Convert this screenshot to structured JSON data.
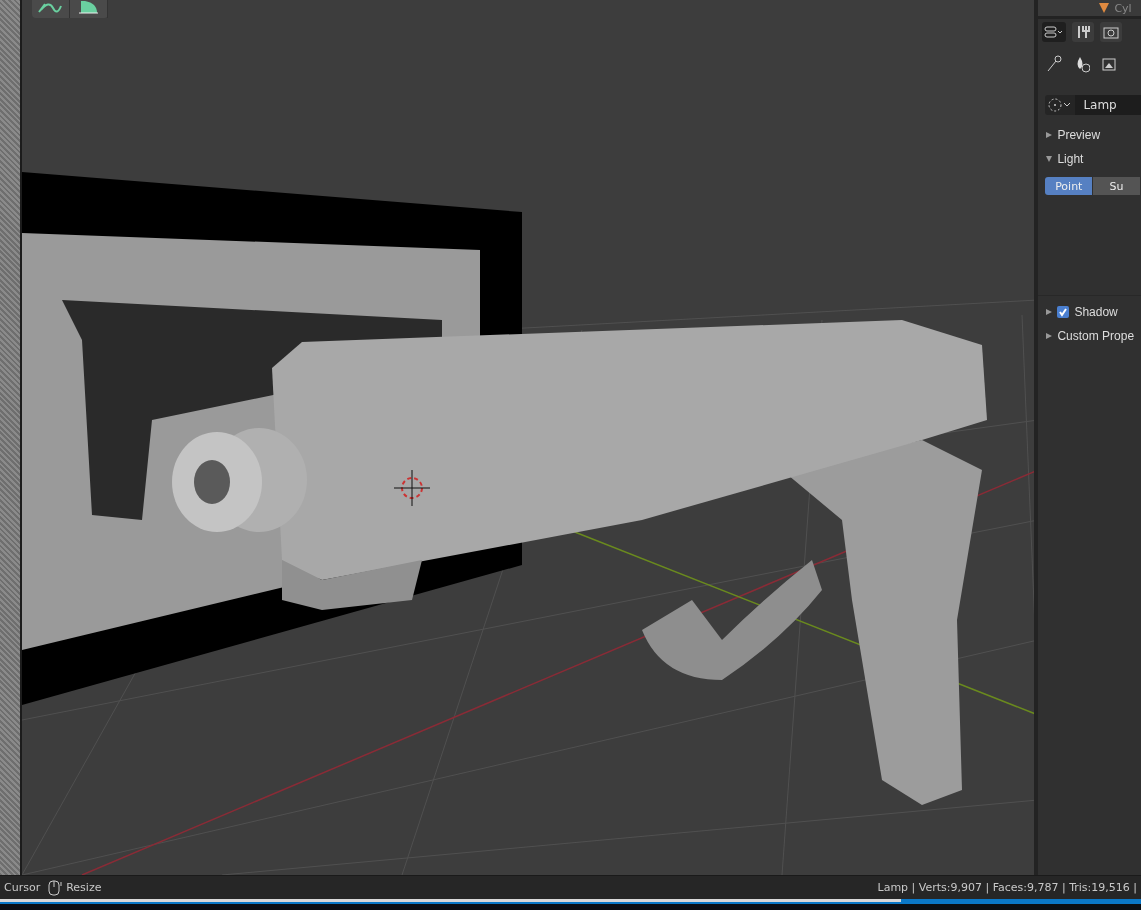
{
  "outliner": {
    "item": "Cyl"
  },
  "properties": {
    "data_block": "Lamp",
    "panels": [
      {
        "label": "Preview",
        "expanded": false
      },
      {
        "label": "Light",
        "expanded": true
      }
    ],
    "light_types": [
      {
        "label": "Point",
        "selected": true
      },
      {
        "label": "Su",
        "selected": false
      }
    ],
    "subpanels": [
      {
        "label": "Shadow",
        "expanded": false,
        "checked": true
      },
      {
        "label": "Custom Prope",
        "expanded": false
      }
    ]
  },
  "status_bar": {
    "hints": [
      "Cursor",
      "Resize"
    ],
    "stats": "Lamp | Verts:9,907 | Faces:9,787 | Tris:19,516 |"
  },
  "progress": {
    "level": 0.79
  }
}
